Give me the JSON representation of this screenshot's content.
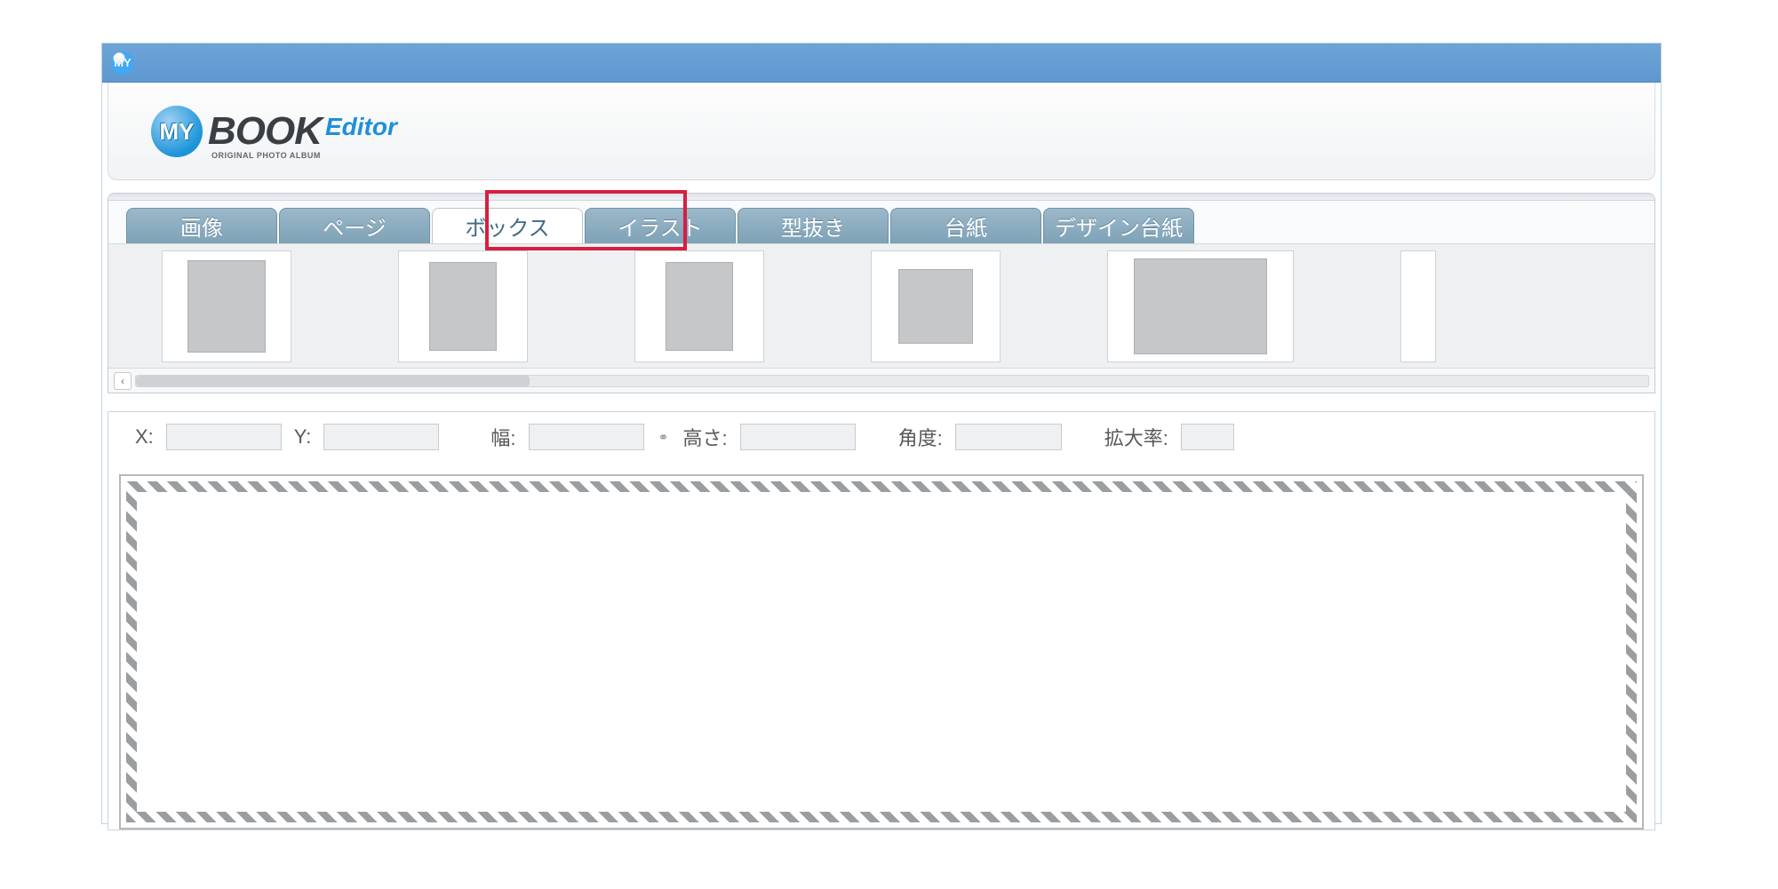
{
  "titlebar": {
    "icon_text": "MY"
  },
  "logo": {
    "my": "MY",
    "book": "BOOK",
    "editor": "Editor",
    "sub": "ORIGINAL PHOTO ALBUM"
  },
  "tabs": {
    "items": [
      {
        "label": "画像",
        "active": false
      },
      {
        "label": "ページ",
        "active": false
      },
      {
        "label": "ボックス",
        "active": true
      },
      {
        "label": "イラスト",
        "active": false
      },
      {
        "label": "型抜き",
        "active": false
      },
      {
        "label": "台紙",
        "active": false
      },
      {
        "label": "デザイン台紙",
        "active": false
      }
    ]
  },
  "scroll": {
    "left_glyph": "‹"
  },
  "props": {
    "x_label": "X:",
    "y_label": "Y:",
    "width_label": "幅:",
    "height_label": "高さ:",
    "angle_label": "角度:",
    "zoom_label": "拡大率:",
    "x": "",
    "y": "",
    "width": "",
    "height": "",
    "angle": "",
    "zoom": ""
  }
}
